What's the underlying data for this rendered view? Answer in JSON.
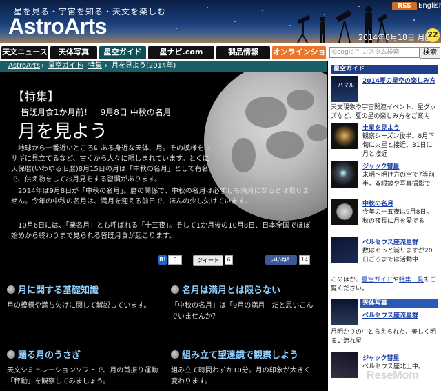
{
  "header": {
    "tagline": "星を見る・宇宙を知る・天文を楽しむ",
    "logo": "AstroArts",
    "rss": "RSS",
    "english": "English",
    "date": "2014年8月18日 月齢",
    "moon_age": "22"
  },
  "nav": {
    "tabs": [
      "天文ニュース",
      "天体写真",
      "星空ガイド",
      "星ナビ.com",
      "製品情報",
      "オンラインショップ"
    ],
    "search_placeholder": "Google™ カスタム検索",
    "search_button": "検索"
  },
  "breadcrumb": [
    "AstroArts",
    "星空ガイド",
    "特集",
    "月を見よう(2014年)"
  ],
  "article": {
    "special": "【特集】",
    "subtitle": "皆既月食1か月前！　9月8日 中秋の名月",
    "title": "月を見よう",
    "p1": "地球から一番近いところにある身近な天体、月。その模様をウサギに見立てるなど、古くから人々に親しまれています。とくに天保暦(いわゆる旧暦)8月15日の月は「中秋の名月」として有名で、供え物をしてお月見をする習慣があります。",
    "p2": "2014年は9月8日が「中秋の名月」。暦の関係で、中秋の名月は必ずしも満月になるとは限りません。今年の中秋の名月は、満月を迎える前日で、ほんの少し欠けています。",
    "p3": "10月6日には、「栗名月」とも呼ばれる「十三夜」。そして1か月後の10月8日、日本全国でほぼ始めから終わりまで見られる皆既月食が起こります。"
  },
  "social": {
    "hatena_label": "B!",
    "hatena_count": "0",
    "tweet_label": "ツイート",
    "tweet_count": "6",
    "like_label": "いいね！",
    "like_count": "14"
  },
  "sections": [
    {
      "title": "月に関する基礎知識",
      "desc": "月の模様や満ち欠けに関して解説しています。"
    },
    {
      "title": "名月は満月とは限らない",
      "desc": "「中秋の名月」は「9月の満月」だと思いこんでいませんか？"
    },
    {
      "title": "踊る月のうさぎ",
      "desc": "天文シミュレーションソフトで、月の首振り運動「秤動」を観察してみましょう。"
    },
    {
      "title": "組み立て望遠鏡で観察しよう",
      "desc": "組み立て時間わずか10分。月の印象が大きく変わります。"
    }
  ],
  "sidebar": {
    "head1": "星空ガイド",
    "items": [
      {
        "title": "2014夏の星空の楽しみ方",
        "desc": "天文現象や宇宙関連イベント、星グッズなど、夏の星の楽しみ方をご案内"
      },
      {
        "title": "土星を見よう",
        "desc": "観察シーズン後半。8月下旬に火星と接近、31日に月と接近"
      },
      {
        "title": "ジャック彗星",
        "desc": "未明～明け方の空で7等前半。双眼鏡や写真撮影で"
      },
      {
        "title": "中秋の名月",
        "desc": "今年の十五夜は9月8日。秋の夜長に月を愛でる"
      },
      {
        "title": "ペルセウス座流星群",
        "desc": "数はぐっと減りますが20日ごろまでは活動中"
      }
    ],
    "more_prefix": "このほか、",
    "more_link1": "星空ガイド",
    "more_mid": "や",
    "more_link2": "特集一覧",
    "more_suffix": "もご覧ください。",
    "thumb_label": "ハマル",
    "head2": "天体写真",
    "photo_items": [
      {
        "title": "ペルセウス座流星群",
        "desc": "月明かりの中とらえられた、美しく明るい流れ星"
      },
      {
        "title": "ジャック彗星",
        "desc": "ペルセウス座北上中。"
      }
    ]
  },
  "watermark": "ReseMom"
}
